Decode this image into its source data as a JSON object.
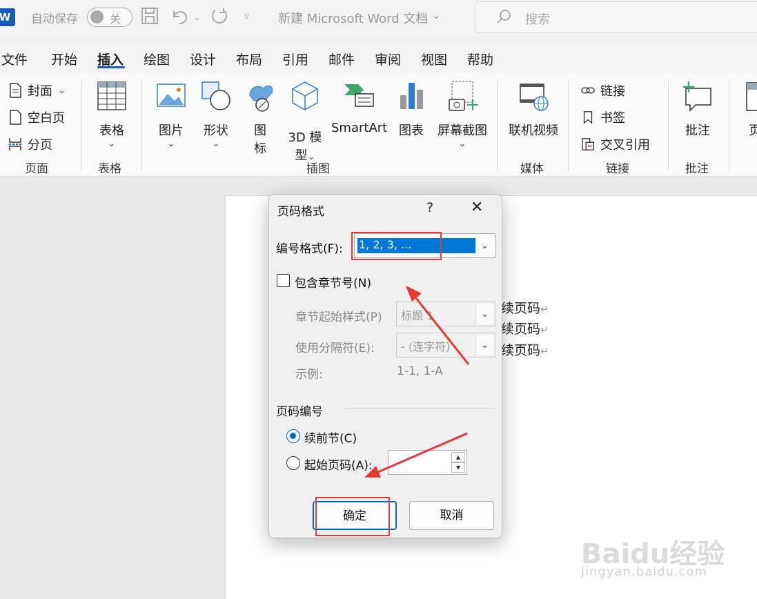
{
  "titlebar": {
    "logo_letter": "W",
    "autosave_label": "自动保存",
    "autosave_state": "关",
    "doc_title": "新建 Microsoft Word 文档",
    "search_placeholder": "搜索"
  },
  "tabs": [
    {
      "label": "文件"
    },
    {
      "label": "开始"
    },
    {
      "label": "插入",
      "active": true
    },
    {
      "label": "绘图"
    },
    {
      "label": "设计"
    },
    {
      "label": "布局"
    },
    {
      "label": "引用"
    },
    {
      "label": "邮件"
    },
    {
      "label": "审阅"
    },
    {
      "label": "视图"
    },
    {
      "label": "帮助"
    }
  ],
  "ribbon": {
    "pages": {
      "cover": "封面",
      "blank": "空白页",
      "break": "分页",
      "group": "页面"
    },
    "tables": {
      "table": "表格",
      "group": "表格"
    },
    "illustrations": {
      "picture": "图片",
      "shapes": "形状",
      "icons_1": "图",
      "icons_2": "标",
      "model_1": "3D 模",
      "model_2": "型",
      "smartart": "SmartArt",
      "chart": "图表",
      "screenshot": "屏幕截图",
      "group": "插图"
    },
    "media": {
      "video": "联机视频",
      "group": "媒体"
    },
    "links": {
      "link": "链接",
      "bookmark": "书签",
      "crossref": "交叉引用",
      "group": "链接"
    },
    "comments": {
      "comment": "批注",
      "group": "批注"
    },
    "header": {
      "label": "页"
    }
  },
  "document": {
    "lines": [
      "续页码",
      "续页码",
      "续页码"
    ]
  },
  "dialog": {
    "title": "页码格式",
    "help": "?",
    "close": "✕",
    "number_format_label": "编号格式(F):",
    "number_format_value": "1, 2, 3, ...",
    "include_chapter_label": "包含章节号(N)",
    "include_chapter_checked": false,
    "chapter_style_label": "章节起始样式(P)",
    "chapter_style_value": "标题 1",
    "separator_label": "使用分隔符(E):",
    "separator_value": "-   (连字符)",
    "example_label": "示例:",
    "example_value": "1-1, 1-A",
    "numbering_group": "页码编号",
    "continue_label": "续前节(C)",
    "start_at_label": "起始页码(A):",
    "start_at_value": "",
    "selected_option": "continue",
    "ok": "确定",
    "cancel": "取消"
  },
  "watermark": {
    "brand": "Baidu经验",
    "url": "jingyan.baidu.com"
  },
  "colors": {
    "accent": "#185abd",
    "selection": "#0078d7",
    "annotation": "#e53935"
  }
}
